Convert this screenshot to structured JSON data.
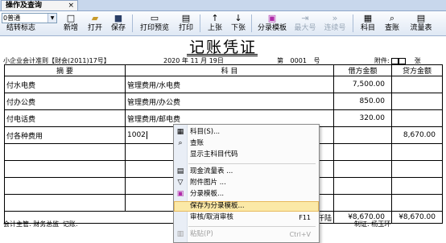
{
  "tab": {
    "title": "操作及查询",
    "close": "×"
  },
  "toolbar": {
    "book_type": "0普通",
    "end_marker": "结转标志",
    "buttons": [
      {
        "label": "新增",
        "icon": "□"
      },
      {
        "label": "打开",
        "icon": "▰"
      },
      {
        "label": "保存",
        "icon": "■"
      },
      {
        "label": "打印预览",
        "icon": "▭"
      },
      {
        "label": "打印",
        "icon": "▤"
      },
      {
        "label": "上张",
        "icon": "↑"
      },
      {
        "label": "下张",
        "icon": "↓"
      },
      {
        "label": "分录模板",
        "icon": "▣"
      },
      {
        "label": "最大号",
        "icon": "⇥"
      },
      {
        "label": "连续号",
        "icon": "»"
      },
      {
        "label": "科目",
        "icon": "▦"
      },
      {
        "label": "查账",
        "icon": "⌕"
      },
      {
        "label": "流量表",
        "icon": "▤"
      }
    ]
  },
  "voucher": {
    "title": "记账凭证",
    "standard": "小企业会计准则【财会(2011)17号】",
    "date": "2020 年 11 月 19日",
    "number_label": "第",
    "number": "0001",
    "number_suffix": "号",
    "attachments_label": "附件:",
    "attachments_unit": "张",
    "headers": {
      "summary": "摘  要",
      "account": "科   目",
      "debit": "借方金额",
      "credit": "贷方金额"
    },
    "rows": [
      {
        "summary": "付水电费",
        "account": "管理费用/水电费",
        "debit": "7,500.00",
        "credit": ""
      },
      {
        "summary": "付办公费",
        "account": "管理费用/办公费",
        "debit": "850.00",
        "credit": ""
      },
      {
        "summary": "付电话费",
        "account": "管理费用/邮电费",
        "debit": "320.00",
        "credit": ""
      },
      {
        "summary": "付各种费用",
        "account": "1002",
        "debit": "",
        "credit": "8,670.00"
      },
      {
        "summary": "",
        "account": "",
        "debit": "",
        "credit": ""
      },
      {
        "summary": "",
        "account": "",
        "debit": "",
        "credit": ""
      },
      {
        "summary": "",
        "account": "",
        "debit": "",
        "credit": ""
      },
      {
        "summary": "",
        "account": "",
        "debit": "",
        "credit": ""
      }
    ],
    "total_label": "合计:捌仟陆",
    "total_debit": "¥8,670.00",
    "total_credit": "¥8,670.00",
    "supervisor": "会计主管: 财务总监",
    "bookkeeper": "记账:",
    "maker": "制证: 杨玉环"
  },
  "context_menu": {
    "items": [
      {
        "label": "科目(S)...",
        "icon": "▦",
        "shortcut": ""
      },
      {
        "label": "查账",
        "icon": "⌕",
        "shortcut": ""
      },
      {
        "label": "显示主科目代码",
        "icon": "",
        "shortcut": ""
      },
      {
        "label": "现金流量表 ...",
        "icon": "▤",
        "shortcut": ""
      },
      {
        "label": "附件图片 ...",
        "icon": "▽",
        "shortcut": ""
      },
      {
        "label": "分录模板...",
        "icon": "▣",
        "shortcut": ""
      },
      {
        "label": "保存为分录模板...",
        "icon": "",
        "shortcut": ""
      },
      {
        "label": "审核/取消审核",
        "icon": "",
        "shortcut": "F11"
      },
      {
        "label": "粘贴(P)",
        "icon": "▥",
        "shortcut": "Ctrl+V"
      }
    ]
  }
}
